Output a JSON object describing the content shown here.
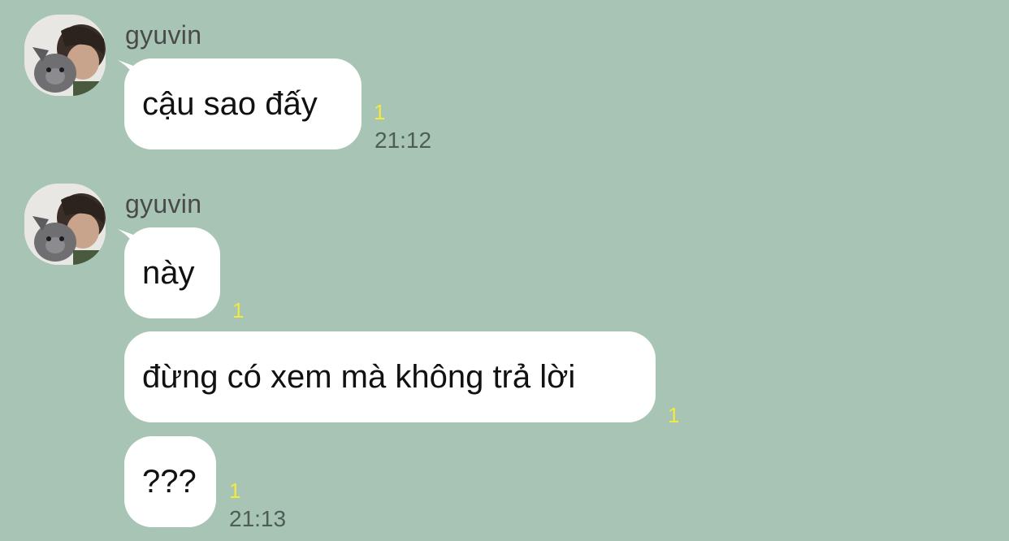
{
  "colors": {
    "background": "#a7c4b5",
    "bubble": "#ffffff",
    "unread_counter": "#f2ea3c",
    "timestamp": "#4f5d57"
  },
  "groups": [
    {
      "sender": "gyuvin",
      "avatar_icon": "profile-photo-with-dog",
      "messages": [
        {
          "text": "cậu sao đấy",
          "unread": "1",
          "time": "21:12"
        }
      ]
    },
    {
      "sender": "gyuvin",
      "avatar_icon": "profile-photo-with-dog",
      "messages": [
        {
          "text": "này",
          "unread": "1",
          "time": ""
        },
        {
          "text": "đừng có xem mà không trả lời",
          "unread": "1",
          "time": ""
        },
        {
          "text": "???",
          "unread": "1",
          "time": "21:13"
        }
      ]
    }
  ]
}
